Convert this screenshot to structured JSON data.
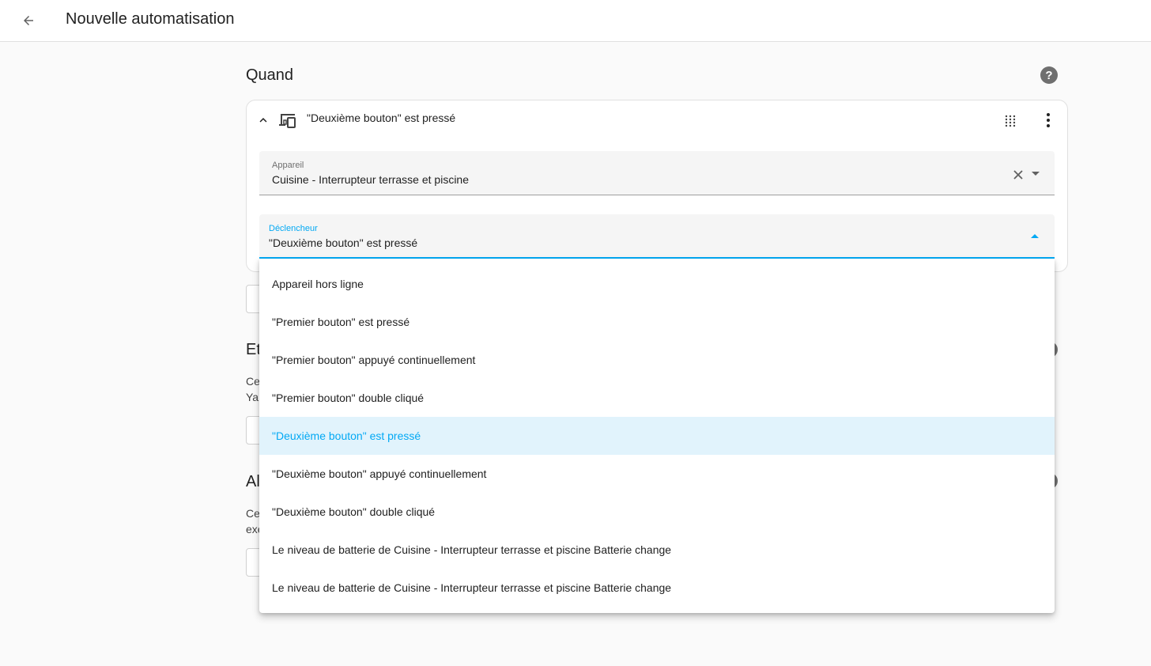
{
  "header": {
    "title": "Nouvelle automatisation"
  },
  "section_when": {
    "title": "Quand"
  },
  "trigger_card": {
    "title": "\"Deuxième bouton\" est pressé",
    "device_field": {
      "label": "Appareil",
      "value": "Cuisine - Interrupteur terrasse et piscine"
    },
    "trigger_field": {
      "label": "Déclencheur",
      "value": "\"Deuxième bouton\" est pressé"
    }
  },
  "background": {
    "and_heading_fragment": "Et",
    "and_text_line1": "Ce",
    "and_text_line2": "Ya",
    "then_heading_fragment": "Al",
    "then_text_line1": "Ce",
    "then_text_line2": "exe"
  },
  "dropdown": {
    "selected_index": 4,
    "options": [
      "Appareil hors ligne",
      "\"Premier bouton\" est pressé",
      "\"Premier bouton\" appuyé continuellement",
      "\"Premier bouton\" double cliqué",
      "\"Deuxième bouton\" est pressé",
      "\"Deuxième bouton\" appuyé continuellement",
      "\"Deuxième bouton\" double cliqué",
      "Le niveau de batterie de Cuisine - Interrupteur terrasse et piscine Batterie change",
      "Le niveau de batterie de Cuisine - Interrupteur terrasse et piscine Batterie change"
    ]
  },
  "colors": {
    "accent": "#03a9f4",
    "selected_bg": "#e1f3fc"
  }
}
